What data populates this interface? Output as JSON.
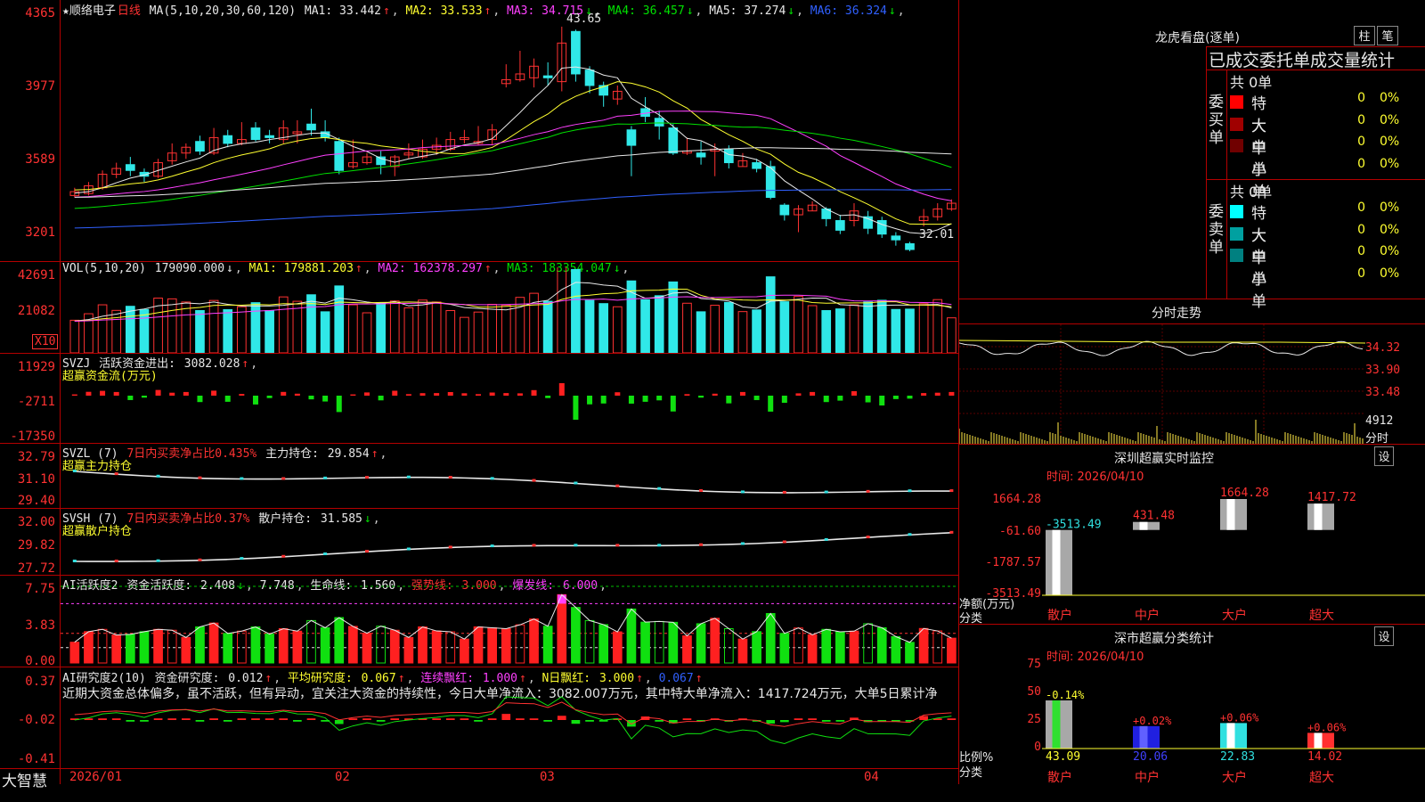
{
  "header": {
    "star_name": "★顺络电子",
    "period": "日线",
    "ma_params": "MA(5,10,20,30,60,120)",
    "ma_vals": [
      {
        "label": "MA1:",
        "val": "33.442",
        "arrow": "↑",
        "color": "#e8e8e8"
      },
      {
        "label": "MA2:",
        "val": "33.533",
        "arrow": "↑",
        "color": "#ffff30"
      },
      {
        "label": "MA3:",
        "val": "34.715",
        "arrow": "↓",
        "color": "#ff40ff"
      },
      {
        "label": "MA4:",
        "val": "36.457",
        "arrow": "↓",
        "color": "#00e000"
      },
      {
        "label": "MA5:",
        "val": "37.274",
        "arrow": "↓",
        "color": "#e8e8e8"
      },
      {
        "label": "MA6:",
        "val": "36.324",
        "arrow": "↓",
        "color": "#3060ff"
      }
    ]
  },
  "price_panel": {
    "yaxis": [
      "4365",
      "3977",
      "3589",
      "3201"
    ],
    "high_label": "43.65",
    "low_label": "32.01",
    "colors": {
      "up": "#ff3232",
      "down": "#30e8e8"
    }
  },
  "vol_panel": {
    "header": "VOL(5,10,20)",
    "main_val": "179090.000",
    "main_arrow": "↓",
    "ma": [
      {
        "label": "MA1:",
        "val": "179881.203",
        "arrow": "↑",
        "color": "#ffff30"
      },
      {
        "label": "MA2:",
        "val": "162378.297",
        "arrow": "↑",
        "color": "#ff40ff"
      },
      {
        "label": "MA3:",
        "val": "183354.047",
        "arrow": "↓",
        "color": "#00e000"
      }
    ],
    "yaxis": [
      "42691",
      "21082"
    ],
    "unit": "X10"
  },
  "svzj_panel": {
    "name": "SVZJ",
    "line1": "活跃资金进出:",
    "val": "3082.028",
    "arrow": "↑",
    "subtitle": "超赢资金流(万元)",
    "yaxis": [
      "11929",
      "-2711",
      "-17350"
    ]
  },
  "svzl_panel": {
    "name": "SVZL (7)",
    "desc": "7日内买卖净占比0.435%",
    "label2": "主力持仓:",
    "val": "29.854",
    "arrow": "↑",
    "subtitle": "超赢主力持仓",
    "yaxis": [
      "32.79",
      "31.10",
      "29.40"
    ]
  },
  "svsh_panel": {
    "name": "SVSH (7)",
    "desc": "7日内买卖净占比0.37%",
    "label2": "散户持仓:",
    "val": "31.585",
    "arrow": "↓",
    "subtitle": "超赢散户持仓",
    "yaxis": [
      "32.00",
      "29.82",
      "27.72"
    ]
  },
  "ai_active": {
    "name": "AI活跃度2",
    "lbl1": "资金活跃度:",
    "v1": "2.408",
    "v1arrow": "↓",
    "v2": "7.748",
    "lbl3": "生命线:",
    "v3": "1.560",
    "lbl4": "强势线:",
    "v4": "3.000",
    "lbl5": "爆发线:",
    "v5": "6.000",
    "yaxis": [
      "7.75",
      "3.83",
      "0.00"
    ]
  },
  "ai_research": {
    "name": "AI研究度2(10)",
    "lbl1": "资金研究度:",
    "v1": "0.012",
    "a1": "↑",
    "lbl2": "平均研究度:",
    "v2": "0.067",
    "a2": "↑",
    "lbl3": "连续飘红:",
    "v3": "1.000",
    "a3": "↑",
    "lbl4": "N日飘红:",
    "v4": "3.000",
    "a4": "↑",
    "v5": "0.067",
    "a5": "↑",
    "comment": "近期大资金总体偏多，虽不活跃，但有异动，宜关注大资金的持续性，今日大单净流入：3082.007万元，其中特大单净流入：1417.724万元，大单5日累计净",
    "yaxis": [
      "0.37",
      "-0.02",
      "-0.41"
    ]
  },
  "xaxis": [
    "2026/01",
    "02",
    "03",
    "04"
  ],
  "brand": "大智慧",
  "right_panel": {
    "top_title": "龙虎看盘(逐单)",
    "btn_bar": "柱",
    "btn_pen": "笔",
    "sub_title": "已成交委托单成交量统计",
    "buy_label": "委买单",
    "sell_label": "委卖单",
    "buy_total": "共 0单",
    "sell_total": "共 0单",
    "buy_rows": [
      {
        "label": "特大",
        "v1": "0",
        "v2": "0%",
        "color": "#ff0000"
      },
      {
        "label": "大单",
        "v1": "0",
        "v2": "0%",
        "color": "#a00000"
      },
      {
        "label": "中单",
        "v1": "0",
        "v2": "0%",
        "color": "#700000"
      },
      {
        "label": "小单",
        "v1": "0",
        "v2": "0%",
        "color": "#000000"
      }
    ],
    "sell_rows": [
      {
        "label": "特大",
        "v1": "0",
        "v2": "0%",
        "color": "#00ffff"
      },
      {
        "label": "大单",
        "v1": "0",
        "v2": "0%",
        "color": "#00a0a0"
      },
      {
        "label": "中单",
        "v1": "0",
        "v2": "0%",
        "color": "#008080"
      },
      {
        "label": "小单",
        "v1": "0",
        "v2": "0%",
        "color": "#000000"
      }
    ],
    "intraday_title": "分时走势",
    "intraday_yaxis": [
      "34.32",
      "33.90",
      "33.48"
    ],
    "intraday_vol": "4912",
    "intraday_xlabel": "分时",
    "sz_monitor_title": "深圳超赢实时监控",
    "sz_set": "设",
    "sz_time": "时间: 2026/04/10",
    "sz_yaxis": [
      "1664.28",
      "-61.60",
      "-1787.57",
      "-3513.49"
    ],
    "sz_ylabel": "净额(万元)",
    "sz_xlabel": "分类",
    "sz_bar_values": [
      "-3513.49",
      "431.48",
      "1664.28",
      "1417.72"
    ],
    "categories": [
      "散户",
      "中户",
      "大户",
      "超大"
    ],
    "cls_title": "深市超赢分类统计",
    "cls_set": "设",
    "cls_time": "时间: 2026/04/10",
    "cls_yaxis": [
      "75",
      "50",
      "25",
      "0"
    ],
    "cls_ylabel": "比例%",
    "cls_xlabel": "分类",
    "cls_changes": [
      "-0.14%",
      "+0.02%",
      "+0.06%",
      "+0.06%"
    ],
    "cls_values": [
      "43.09",
      "20.06",
      "22.83",
      "14.02"
    ]
  },
  "chart_data": {
    "type": "candlestick",
    "sz_monitor": {
      "categories": [
        "散户",
        "中户",
        "大户",
        "超大"
      ],
      "values": [
        -3513.49,
        431.48,
        1664.28,
        1417.72
      ]
    },
    "cls_stat": {
      "categories": [
        "散户",
        "中户",
        "大户",
        "超大"
      ],
      "values": [
        43.09,
        20.06,
        22.83,
        14.02
      ]
    },
    "candles": [
      [
        34.9,
        35.1,
        35.3,
        34.8
      ],
      [
        35.0,
        35.4,
        35.6,
        34.9
      ],
      [
        35.3,
        36.0,
        36.2,
        35.2
      ],
      [
        36.0,
        36.3,
        36.6,
        35.8
      ],
      [
        36.5,
        36.2,
        36.9,
        35.9
      ],
      [
        36.1,
        35.9,
        36.3,
        35.6
      ],
      [
        35.9,
        36.6,
        36.8,
        35.8
      ],
      [
        36.7,
        37.1,
        37.6,
        36.5
      ],
      [
        37.1,
        37.4,
        37.6,
        36.8
      ],
      [
        37.7,
        37.2,
        38.0,
        37.0
      ],
      [
        37.1,
        37.9,
        38.4,
        37.0
      ],
      [
        38.0,
        37.6,
        38.3,
        37.4
      ],
      [
        37.6,
        37.8,
        38.7,
        37.5
      ],
      [
        38.4,
        37.8,
        38.7,
        37.7
      ],
      [
        38.0,
        37.9,
        38.3,
        37.6
      ],
      [
        37.8,
        38.4,
        38.8,
        37.6
      ],
      [
        38.1,
        38.2,
        38.8,
        37.6
      ],
      [
        38.6,
        38.3,
        39.4,
        38.0
      ],
      [
        38.2,
        37.9,
        38.8,
        37.7
      ],
      [
        37.7,
        36.2,
        37.9,
        36.0
      ],
      [
        36.4,
        36.6,
        37.8,
        36.3
      ],
      [
        36.6,
        36.9,
        37.1,
        36.5
      ],
      [
        36.9,
        36.5,
        37.2,
        36.0
      ],
      [
        36.4,
        36.9,
        37.0,
        35.9
      ],
      [
        37.0,
        37.1,
        37.6,
        36.8
      ],
      [
        36.9,
        37.3,
        37.8,
        36.8
      ],
      [
        37.3,
        37.5,
        37.9,
        37.0
      ],
      [
        37.3,
        37.8,
        38.2,
        37.2
      ],
      [
        37.8,
        37.9,
        38.3,
        37.6
      ],
      [
        37.6,
        37.7,
        38.5,
        37.5
      ],
      [
        37.8,
        38.3,
        38.6,
        37.5
      ],
      [
        40.7,
        40.9,
        41.7,
        40.5
      ],
      [
        40.9,
        41.2,
        42.4,
        40.8
      ],
      [
        41.0,
        41.6,
        42.0,
        40.5
      ],
      [
        41.1,
        41.0,
        41.8,
        40.6
      ],
      [
        40.8,
        42.8,
        43.65,
        40.3
      ],
      [
        43.4,
        41.2,
        43.5,
        40.8
      ],
      [
        41.4,
        40.6,
        41.6,
        40.2
      ],
      [
        40.6,
        40.1,
        40.8,
        39.5
      ],
      [
        39.9,
        40.3,
        40.6,
        39.6
      ],
      [
        38.3,
        37.5,
        38.5,
        35.9
      ],
      [
        39.4,
        39.0,
        40.0,
        38.7
      ],
      [
        38.9,
        38.5,
        39.3,
        37.8
      ],
      [
        38.4,
        37.1,
        38.6,
        37.0
      ],
      [
        37.1,
        37.2,
        37.9,
        37.0
      ],
      [
        37.1,
        36.9,
        37.7,
        36.5
      ],
      [
        37.2,
        37.3,
        37.6,
        35.9
      ],
      [
        37.3,
        36.6,
        37.5,
        36.3
      ],
      [
        36.4,
        36.7,
        37.1,
        36.4
      ],
      [
        36.6,
        36.3,
        36.8,
        36.1
      ],
      [
        36.4,
        34.8,
        36.7,
        34.7
      ],
      [
        34.4,
        33.9,
        34.5,
        33.6
      ],
      [
        33.9,
        34.2,
        34.4,
        33.0
      ],
      [
        34.1,
        34.4,
        34.6,
        34.1
      ],
      [
        34.2,
        33.7,
        34.3,
        33.3
      ],
      [
        33.6,
        33.1,
        33.9,
        32.9
      ],
      [
        33.6,
        34.1,
        34.5,
        33.3
      ],
      [
        33.8,
        33.2,
        34.1,
        32.9
      ],
      [
        33.6,
        32.9,
        33.8,
        32.7
      ],
      [
        32.8,
        32.6,
        33.0,
        32.3
      ],
      [
        32.4,
        32.1,
        32.5,
        32.01
      ],
      [
        33.6,
        33.8,
        34.2,
        33.3
      ],
      [
        33.8,
        34.2,
        34.5,
        33.6
      ],
      [
        34.2,
        34.5,
        34.7,
        34.1
      ]
    ]
  }
}
